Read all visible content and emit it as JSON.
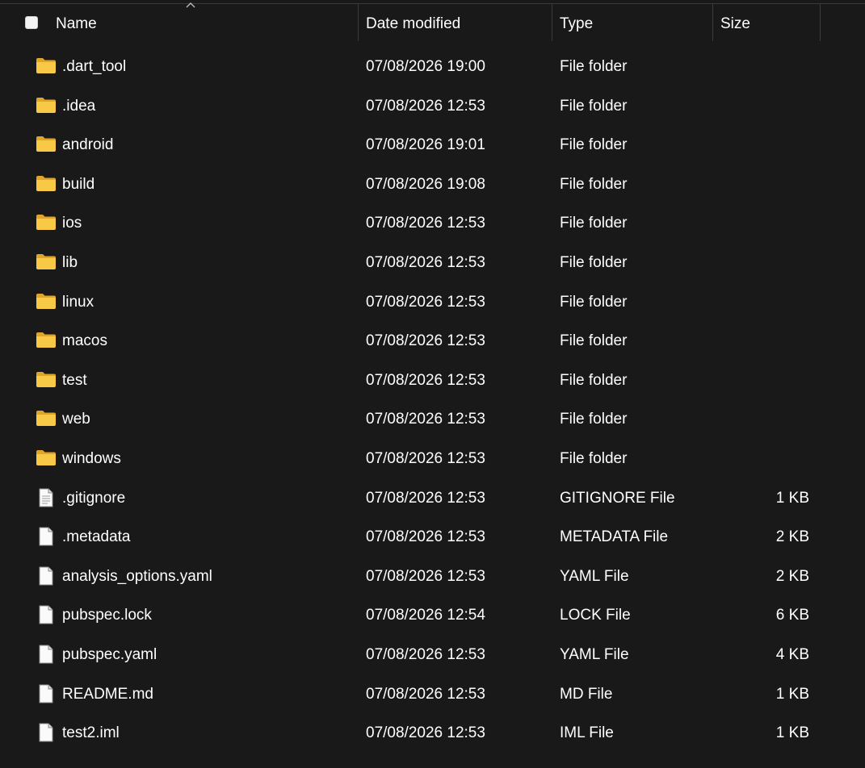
{
  "header": {
    "name_label": "Name",
    "date_label": "Date modified",
    "type_label": "Type",
    "size_label": "Size",
    "sort_column": "Name",
    "sort_direction": "ascending"
  },
  "files": [
    {
      "name": ".dart_tool",
      "date": "07/08/2026 19:00",
      "type": "File folder",
      "size": "",
      "icon": "folder-icon"
    },
    {
      "name": ".idea",
      "date": "07/08/2026 12:53",
      "type": "File folder",
      "size": "",
      "icon": "folder-icon"
    },
    {
      "name": "android",
      "date": "07/08/2026 19:01",
      "type": "File folder",
      "size": "",
      "icon": "folder-icon"
    },
    {
      "name": "build",
      "date": "07/08/2026 19:08",
      "type": "File folder",
      "size": "",
      "icon": "folder-icon"
    },
    {
      "name": "ios",
      "date": "07/08/2026 12:53",
      "type": "File folder",
      "size": "",
      "icon": "folder-icon"
    },
    {
      "name": "lib",
      "date": "07/08/2026 12:53",
      "type": "File folder",
      "size": "",
      "icon": "folder-icon"
    },
    {
      "name": "linux",
      "date": "07/08/2026 12:53",
      "type": "File folder",
      "size": "",
      "icon": "folder-icon"
    },
    {
      "name": "macos",
      "date": "07/08/2026 12:53",
      "type": "File folder",
      "size": "",
      "icon": "folder-icon"
    },
    {
      "name": "test",
      "date": "07/08/2026 12:53",
      "type": "File folder",
      "size": "",
      "icon": "folder-icon"
    },
    {
      "name": "web",
      "date": "07/08/2026 12:53",
      "type": "File folder",
      "size": "",
      "icon": "folder-icon"
    },
    {
      "name": "windows",
      "date": "07/08/2026 12:53",
      "type": "File folder",
      "size": "",
      "icon": "folder-icon"
    },
    {
      "name": ".gitignore",
      "date": "07/08/2026 12:53",
      "type": "GITIGNORE File",
      "size": "1 KB",
      "icon": "text-file-icon"
    },
    {
      "name": ".metadata",
      "date": "07/08/2026 12:53",
      "type": "METADATA File",
      "size": "2 KB",
      "icon": "blank-file-icon"
    },
    {
      "name": "analysis_options.yaml",
      "date": "07/08/2026 12:53",
      "type": "YAML File",
      "size": "2 KB",
      "icon": "blank-file-icon"
    },
    {
      "name": "pubspec.lock",
      "date": "07/08/2026 12:54",
      "type": "LOCK File",
      "size": "6 KB",
      "icon": "blank-file-icon"
    },
    {
      "name": "pubspec.yaml",
      "date": "07/08/2026 12:53",
      "type": "YAML File",
      "size": "4 KB",
      "icon": "blank-file-icon"
    },
    {
      "name": "README.md",
      "date": "07/08/2026 12:53",
      "type": "MD File",
      "size": "1 KB",
      "icon": "blank-file-icon"
    },
    {
      "name": "test2.iml",
      "date": "07/08/2026 12:53",
      "type": "IML File",
      "size": "1 KB",
      "icon": "blank-file-icon"
    }
  ],
  "colors": {
    "background": "#191919",
    "folder_yellow": "#f8c847",
    "folder_back": "#e8ad2c",
    "text": "#ffffff",
    "divider": "#3c3c3c"
  }
}
